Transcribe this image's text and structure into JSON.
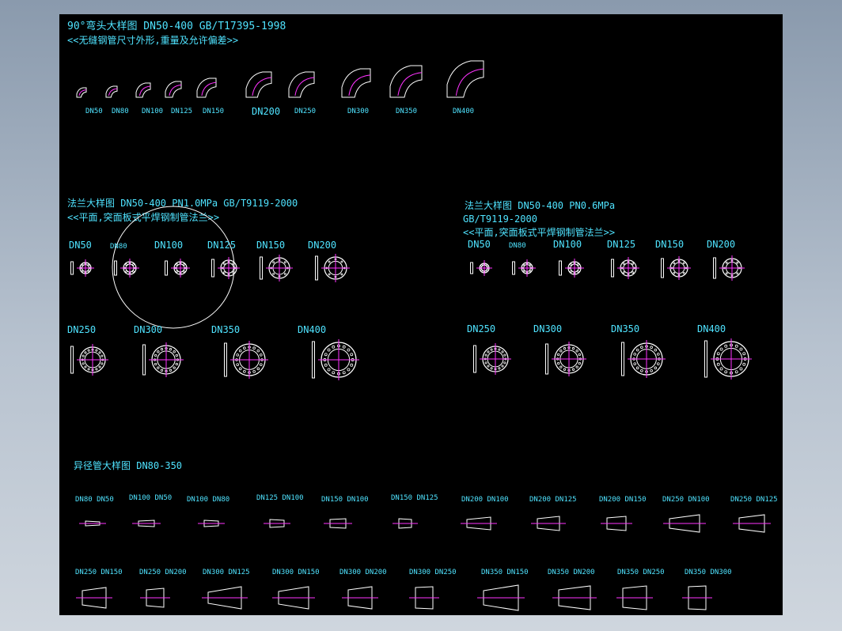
{
  "colors": {
    "background": "#000000",
    "text": "#4fe3ff",
    "line": "#ffffff",
    "center": "#ff33ff",
    "workspace": "#8a9aad"
  },
  "elbow": {
    "title": "90°弯头大样图 DN50-400 GB/T17395-1998",
    "subtitle": "<<无缝钢管尺寸外形,重量及允许偏差>>",
    "sizes": [
      "DN50",
      "DN80",
      "DN100",
      "DN125",
      "DN150",
      "DN200",
      "DN250",
      "DN300",
      "DN350",
      "DN400"
    ]
  },
  "flange_left": {
    "title": "法兰大样图 DN50-400 PN1.0MPa GB/T9119-2000",
    "subtitle": "<<平面,突面板式平焊钢制管法兰>>",
    "row1": [
      "DN50",
      "DN80",
      "DN100",
      "DN125",
      "DN150",
      "DN200"
    ],
    "row2": [
      "DN250",
      "DN300",
      "DN350",
      "DN400"
    ]
  },
  "flange_right": {
    "title": "法兰大样图 DN50-400 PN0.6MPa",
    "standard": "GB/T9119-2000",
    "subtitle": "<<平面,突面板式平焊钢制管法兰>>",
    "row1": [
      "DN50",
      "DN80",
      "DN100",
      "DN125",
      "DN150",
      "DN200"
    ],
    "row2": [
      "DN250",
      "DN300",
      "DN350",
      "DN400"
    ]
  },
  "reducer": {
    "title": "异径管大样图 DN80-350",
    "row1": [
      "DN80 DN50",
      "DN100 DN50",
      "DN100 DN80",
      "DN125 DN100",
      "DN150 DN100",
      "DN150 DN125",
      "DN200 DN100",
      "DN200 DN125",
      "DN200 DN150",
      "DN250 DN100",
      "DN250 DN125"
    ],
    "row2": [
      "DN250 DN150",
      "DN250 DN200",
      "DN300 DN125",
      "DN300 DN150",
      "DN300 DN200",
      "DN300 DN250",
      "DN350 DN150",
      "DN350 DN200",
      "DN350 DN250",
      "DN350 DN300"
    ]
  }
}
